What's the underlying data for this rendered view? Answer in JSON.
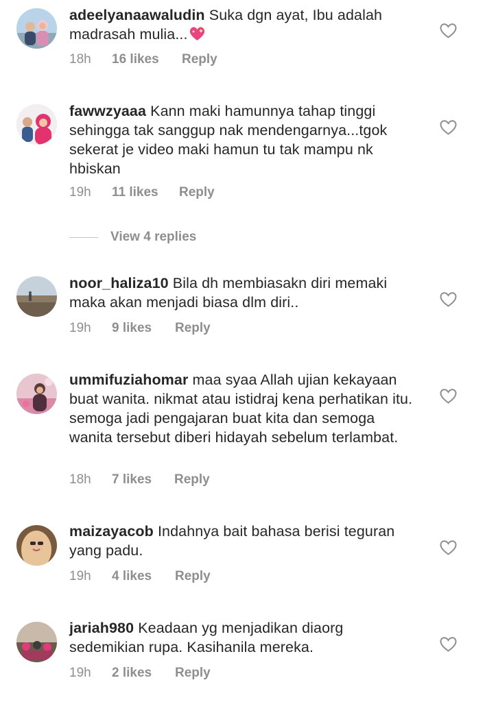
{
  "comments": [
    {
      "username": "adeelyanaawaludin",
      "text": "Suka dgn ayat, Ibu adalah madrasah mulia...",
      "emoji": "sparkling-heart-icon",
      "time": "18h",
      "likes": "16 likes",
      "reply": "Reply"
    },
    {
      "username": "fawwzyaaa",
      "text": "Kann maki hamunnya tahap tinggi sehingga tak sanggup nak mendengarnya...tgok sekerat je video maki hamun tu tak mampu nk hbiskan",
      "time": "19h",
      "likes": "11 likes",
      "reply": "Reply"
    },
    {
      "username": "noor_haliza10",
      "text": "Bila dh membiasakn diri memaki maka akan menjadi biasa dlm diri..",
      "time": "19h",
      "likes": "9 likes",
      "reply": "Reply"
    },
    {
      "username": "ummifuziahomar",
      "text": "maa syaa Allah ujian kekayaan buat wanita. nikmat atau istidraj kena perhatikan itu. semoga jadi pengajaran buat kita dan semoga wanita tersebut diberi hidayah sebelum terlambat.",
      "time": "18h",
      "likes": "7 likes",
      "reply": "Reply"
    },
    {
      "username": "maizayacob",
      "text": "Indahnya bait bahasa berisi teguran yang padu.",
      "time": "19h",
      "likes": "4 likes",
      "reply": "Reply"
    },
    {
      "username": "jariah980",
      "text": "Keadaan yg menjadikan diaorg sedemikian rupa. Kasihanila mereka.",
      "time": "19h",
      "likes": "2 likes",
      "reply": "Reply"
    }
  ],
  "view_replies": "View 4 replies",
  "icons": {
    "like": "heart-outline-icon"
  },
  "colors": {
    "text": "#262626",
    "secondary": "#8e8e8e",
    "divider": "#c7c7c7",
    "emoji": "#e8457f"
  }
}
